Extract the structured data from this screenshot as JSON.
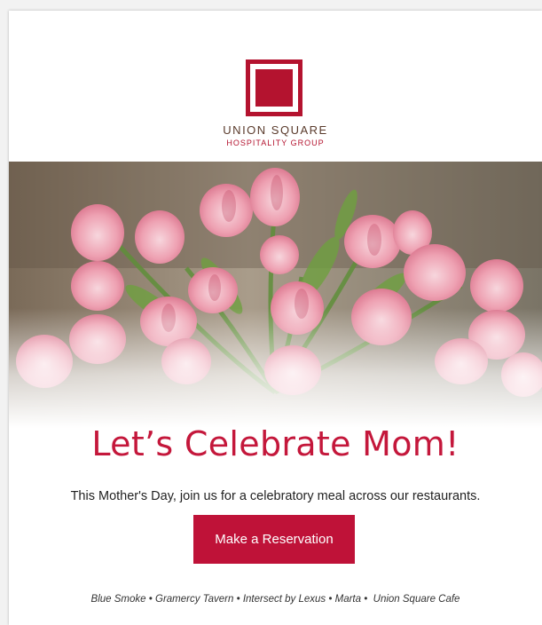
{
  "brand": {
    "line1": "UNION SQUARE",
    "line2": "HOSPITALITY GROUP",
    "logo_icon": "square-logo-icon",
    "accent": "#b4132f"
  },
  "hero": {
    "image": "pink-tulips-bouquet"
  },
  "headline": "Let’s Celebrate Mom!",
  "subtext": "This Mother's Day, join us for a celebratory meal across our restaurants.",
  "cta": {
    "label": "Make a Reservation",
    "color": "#bf1238"
  },
  "restaurants": [
    "Blue Smoke",
    "Gramercy Tavern",
    "Intersect by Lexus",
    "Marta",
    "Union Square Cafe"
  ],
  "separator": "•"
}
